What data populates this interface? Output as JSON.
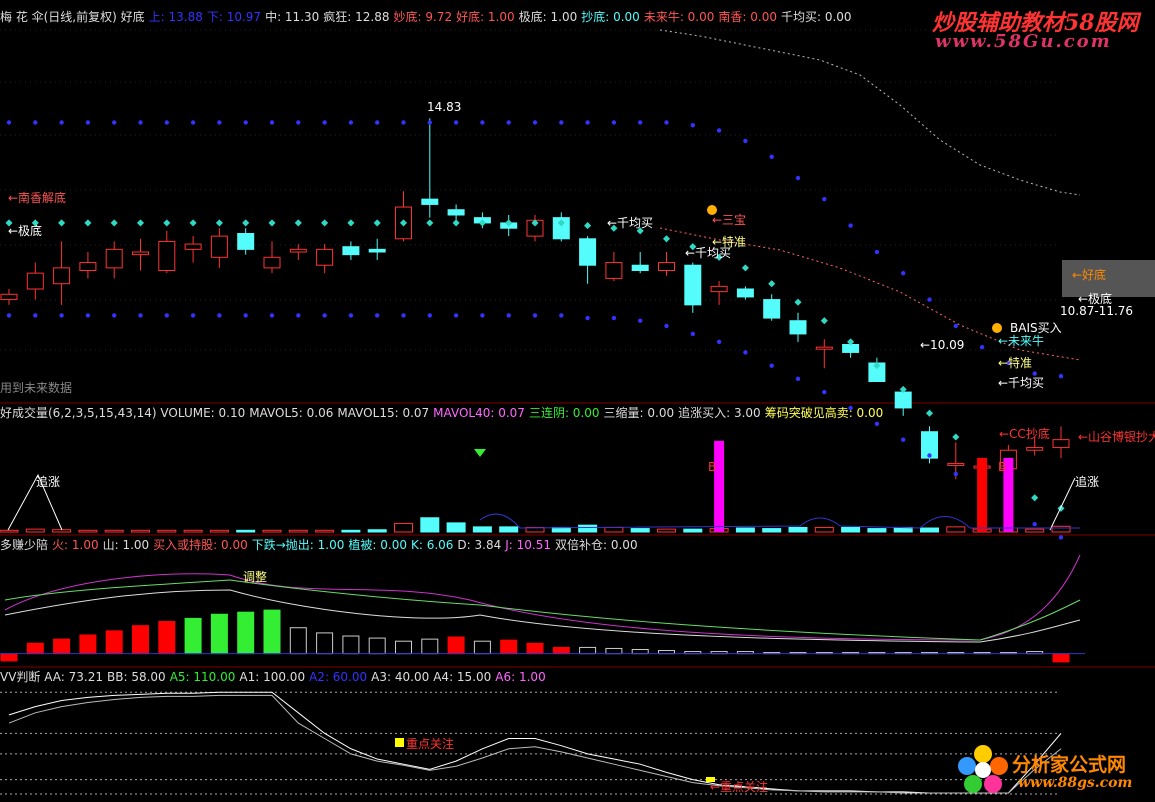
{
  "colors": {
    "bg": "#000000",
    "up": "#ff3232",
    "down": "#54fcfc",
    "text": "#dddddd",
    "cyan_dot": "#2fd9c4",
    "blue_dot": "#3333ff",
    "magenta": "#ff00ff",
    "red": "#ff0000",
    "green": "#33ee33",
    "yellow": "#ffff00",
    "grid_red": "#800000"
  },
  "header1": {
    "items": [
      {
        "text": "梅 花 伞(日线,前复权) 好底",
        "color": "#dddddd"
      },
      {
        "text": "上: 13.88",
        "color": "#3333ff"
      },
      {
        "text": "下: 10.97",
        "color": "#3333ff"
      },
      {
        "text": "中: 11.30",
        "color": "#dddddd"
      },
      {
        "text": "疯狂: 12.88",
        "color": "#dddddd"
      },
      {
        "text": "妙底: 9.72",
        "color": "#ff5555"
      },
      {
        "text": "好底: 1.00",
        "color": "#ff5555"
      },
      {
        "text": "极底: 1.00",
        "color": "#dddddd"
      },
      {
        "text": "抄底: 0.00",
        "color": "#54fcfc"
      },
      {
        "text": "未来牛: 0.00",
        "color": "#ff5555"
      },
      {
        "text": "南香: 0.00",
        "color": "#ff5555"
      },
      {
        "text": "千均买: 0.00",
        "color": "#dddddd"
      }
    ]
  },
  "header2": {
    "items": [
      {
        "text": "好成交量(6,2,3,5,15,43,14) VOLUME: 0.10",
        "color": "#dddddd"
      },
      {
        "text": "MAVOL5: 0.06",
        "color": "#dddddd"
      },
      {
        "text": "MAVOL15: 0.07",
        "color": "#dddddd"
      },
      {
        "text": "MAVOL40: 0.07",
        "color": "#ff66ff"
      },
      {
        "text": "三连阴: 0.00",
        "color": "#33ee33"
      },
      {
        "text": "三缩量: 0.00",
        "color": "#dddddd"
      },
      {
        "text": "追涨买入: 3.00",
        "color": "#dddddd"
      },
      {
        "text": "筹码突破见高卖: 0.00",
        "color": "#ffff55"
      }
    ]
  },
  "header3": {
    "items": [
      {
        "text": "多赚少陪",
        "color": "#dddddd"
      },
      {
        "text": "火: 1.00",
        "color": "#ff5555"
      },
      {
        "text": "山: 1.00",
        "color": "#dddddd"
      },
      {
        "text": "买入或持股: 0.00",
        "color": "#ff5555"
      },
      {
        "text": "下跌→抛出: 1.00",
        "color": "#54fcfc"
      },
      {
        "text": "植被: 0.00",
        "color": "#54fcfc"
      },
      {
        "text": "K: 6.06",
        "color": "#54fcfc"
      },
      {
        "text": "D: 3.84",
        "color": "#dddddd"
      },
      {
        "text": "J: 10.51",
        "color": "#ff66ff"
      },
      {
        "text": "双倍补仓: 0.00",
        "color": "#dddddd"
      }
    ]
  },
  "header4": {
    "items": [
      {
        "text": "VV判断 AA: 73.21",
        "color": "#dddddd"
      },
      {
        "text": "BB: 58.00",
        "color": "#dddddd"
      },
      {
        "text": "A5: 110.00",
        "color": "#33ee33"
      },
      {
        "text": "A1: 100.00",
        "color": "#dddddd"
      },
      {
        "text": "A2: 60.00",
        "color": "#3333ff"
      },
      {
        "text": "A3: 40.00",
        "color": "#dddddd"
      },
      {
        "text": "A4: 15.00",
        "color": "#dddddd"
      },
      {
        "text": "A6: 1.00",
        "color": "#ff66ff"
      }
    ]
  },
  "labels": {
    "price_high": "14.83",
    "price_low": "←10.09",
    "price_range": "10.87-11.76",
    "nanxiang_jiedi": "←南香解底",
    "jidi_left": "←极底",
    "qianjunmai_1": "←千均买",
    "qianjunmai_2": "←千均买",
    "sanbao": "←三宝",
    "tezhun_1": "←特准",
    "haodi": "←好底",
    "jidi_right": "←极底",
    "bais": "BAIS买入",
    "weilainiu": "←未来牛",
    "tezhun_2": "←特准",
    "qianjunmai_3": "←千均买",
    "future_data": "用到未来数据",
    "ccchaodi": "←CC抄底",
    "shangusha": "←山谷博银抄大",
    "zhuizhang_left": "追涨",
    "zhuizhang_right": "追涨",
    "b_mark_1": "B",
    "b_mark_2": "B",
    "tiaozheng": "调整",
    "zhongdian_1": "重点关注",
    "zhongdian_2": "←重点关注"
  },
  "watermark": {
    "line1": "炒股辅助教材58股网",
    "line2": "www.58Gu.com",
    "logo_text": "分析家公式网",
    "logo_url_text": "www.88gs.com"
  },
  "chart_data": [
    {
      "type": "candlestick",
      "title": "梅 花 伞(日线,前复权)",
      "ylim": [
        9.5,
        16.5
      ],
      "candles": [
        {
          "o": 11.4,
          "c": 11.5,
          "h": 11.6,
          "l": 11.3
        },
        {
          "o": 11.6,
          "c": 11.9,
          "h": 12.1,
          "l": 11.4
        },
        {
          "o": 11.7,
          "c": 12.0,
          "h": 12.5,
          "l": 11.3
        },
        {
          "o": 11.95,
          "c": 12.1,
          "h": 12.3,
          "l": 11.8
        },
        {
          "o": 12.0,
          "c": 12.35,
          "h": 12.5,
          "l": 11.8
        },
        {
          "o": 12.25,
          "c": 12.3,
          "h": 12.55,
          "l": 11.95
        },
        {
          "o": 11.95,
          "c": 12.5,
          "h": 12.7,
          "l": 11.9
        },
        {
          "o": 12.35,
          "c": 12.45,
          "h": 12.6,
          "l": 12.1
        },
        {
          "o": 12.2,
          "c": 12.6,
          "h": 12.75,
          "l": 12.0
        },
        {
          "o": 12.65,
          "c": 12.35,
          "h": 12.75,
          "l": 12.25
        },
        {
          "o": 12.0,
          "c": 12.2,
          "h": 12.5,
          "l": 11.9
        },
        {
          "o": 12.3,
          "c": 12.35,
          "h": 12.45,
          "l": 12.15
        },
        {
          "o": 12.05,
          "c": 12.35,
          "h": 12.45,
          "l": 11.9
        },
        {
          "o": 12.4,
          "c": 12.25,
          "h": 12.5,
          "l": 12.15
        },
        {
          "o": 12.35,
          "c": 12.3,
          "h": 12.55,
          "l": 12.15
        },
        {
          "o": 12.55,
          "c": 13.15,
          "h": 13.45,
          "l": 12.5
        },
        {
          "o": 13.3,
          "c": 13.2,
          "h": 14.83,
          "l": 12.95
        },
        {
          "o": 13.1,
          "c": 13.0,
          "h": 13.2,
          "l": 12.85
        },
        {
          "o": 12.95,
          "c": 12.85,
          "h": 13.05,
          "l": 12.75
        },
        {
          "o": 12.85,
          "c": 12.75,
          "h": 13.0,
          "l": 12.6
        },
        {
          "o": 12.6,
          "c": 12.9,
          "h": 13.0,
          "l": 12.5
        },
        {
          "o": 12.95,
          "c": 12.55,
          "h": 13.05,
          "l": 12.5
        },
        {
          "o": 12.55,
          "c": 12.05,
          "h": 12.6,
          "l": 11.7
        },
        {
          "o": 11.8,
          "c": 12.1,
          "h": 12.3,
          "l": 11.75
        },
        {
          "o": 12.05,
          "c": 11.95,
          "h": 12.3,
          "l": 11.9
        },
        {
          "o": 11.95,
          "c": 12.1,
          "h": 12.3,
          "l": 11.85
        },
        {
          "o": 12.05,
          "c": 11.3,
          "h": 12.1,
          "l": 11.15
        },
        {
          "o": 11.55,
          "c": 11.65,
          "h": 11.75,
          "l": 11.3
        },
        {
          "o": 11.6,
          "c": 11.45,
          "h": 11.65,
          "l": 11.4
        },
        {
          "o": 11.4,
          "c": 11.05,
          "h": 11.5,
          "l": 11.0
        },
        {
          "o": 11.0,
          "c": 10.75,
          "h": 11.15,
          "l": 10.6
        },
        {
          "o": 10.5,
          "c": 10.5,
          "h": 10.65,
          "l": 10.1
        },
        {
          "o": 10.55,
          "c": 10.4,
          "h": 10.65,
          "l": 10.3
        },
        {
          "o": 10.2,
          "c": 9.85,
          "h": 10.3,
          "l": 9.85
        },
        {
          "o": 9.65,
          "c": 9.35,
          "h": 9.75,
          "l": 9.2
        },
        {
          "o": 8.9,
          "c": 8.4,
          "h": 9.0,
          "l": 8.3
        },
        {
          "o": 8.3,
          "c": 8.3,
          "h": 8.7,
          "l": 8.0
        },
        {
          "o": 8.25,
          "c": 8.25,
          "h": 8.4,
          "l": 8.1
        },
        {
          "o": 8.2,
          "c": 8.55,
          "h": 8.65,
          "l": 8.0
        },
        {
          "o": 8.55,
          "c": 8.6,
          "h": 8.8,
          "l": 8.45
        },
        {
          "o": 8.6,
          "c": 8.75,
          "h": 9.0,
          "l": 8.4
        }
      ],
      "upper_dots": [
        14.75,
        14.75,
        14.75,
        14.75,
        14.75,
        14.75,
        14.75,
        14.75,
        14.75,
        14.75,
        14.75,
        14.75,
        14.75,
        14.75,
        14.75,
        14.75,
        14.75,
        14.75,
        14.75,
        14.75,
        14.75,
        14.75,
        14.75,
        14.75,
        14.75,
        14.75,
        14.7,
        14.6,
        14.4,
        14.1,
        13.7,
        13.3,
        12.8,
        12.3,
        11.9,
        11.4,
        10.9,
        10.5,
        10.2,
        10.0,
        9.95
      ],
      "mid_dots": [
        12.85,
        12.85,
        12.85,
        12.85,
        12.85,
        12.85,
        12.85,
        12.85,
        12.85,
        12.85,
        12.85,
        12.85,
        12.85,
        12.85,
        12.85,
        12.85,
        12.85,
        12.85,
        12.85,
        12.85,
        12.85,
        12.85,
        12.8,
        12.75,
        12.7,
        12.55,
        12.4,
        12.2,
        12.0,
        11.7,
        11.35,
        11.0,
        10.6,
        10.15,
        9.7,
        9.25,
        8.8,
        8.3,
        7.95,
        7.65,
        7.45
      ],
      "lower_dots": [
        11.1,
        11.1,
        11.1,
        11.1,
        11.1,
        11.1,
        11.1,
        11.1,
        11.1,
        11.1,
        11.1,
        11.1,
        11.1,
        11.1,
        11.1,
        11.1,
        11.1,
        11.1,
        11.1,
        11.1,
        11.1,
        11.1,
        11.05,
        11.05,
        11.0,
        10.9,
        10.75,
        10.6,
        10.4,
        10.15,
        9.9,
        9.65,
        9.35,
        9.05,
        8.75,
        8.45,
        8.1,
        7.75,
        7.45,
        7.15,
        6.9
      ]
    },
    {
      "type": "bar",
      "title": "好成交量(6,2,3,5,15,43,14)",
      "volume": [
        0.3,
        0.5,
        0.4,
        0.3,
        0.3,
        0.3,
        0.3,
        0.3,
        0.3,
        0.3,
        0.3,
        0.3,
        0.3,
        0.3,
        0.4,
        1.5,
        2.5,
        1.6,
        0.9,
        0.9,
        0.8,
        0.8,
        1.2,
        0.8,
        0.6,
        0.5,
        0.5,
        0.6,
        0.7,
        0.6,
        0.8,
        0.8,
        0.8,
        0.6,
        0.8,
        0.7,
        0.9,
        0.5,
        0.7,
        0.5,
        1.0
      ],
      "b_signal_bars": [
        {
          "index": 27,
          "value": 16
        },
        {
          "index": 37,
          "value": 13
        },
        {
          "index": 38,
          "value": 13
        }
      ],
      "ylim": [
        0,
        20
      ]
    },
    {
      "type": "bar",
      "title": "多赚少陪",
      "values": [
        -7,
        10,
        14,
        18,
        22,
        27,
        31,
        34,
        38,
        40,
        42,
        25,
        20,
        17,
        15,
        12,
        14,
        16,
        12,
        13,
        10,
        6,
        6,
        5,
        4,
        3,
        2,
        2,
        2,
        1,
        1,
        1,
        1,
        1,
        1,
        1,
        1,
        1,
        1,
        2,
        -8
      ],
      "signs": [
        "red",
        "red",
        "red",
        "red",
        "red",
        "red",
        "red",
        "green",
        "green",
        "green",
        "green",
        "hollow",
        "hollow",
        "hollow",
        "hollow",
        "hollow",
        "hollow",
        "red",
        "hollow",
        "red",
        "red",
        "red",
        "hollow",
        "hollow",
        "hollow",
        "hollow",
        "hollow",
        "hollow",
        "hollow",
        "hollow",
        "hollow",
        "hollow",
        "hollow",
        "hollow",
        "hollow",
        "hollow",
        "hollow",
        "hollow",
        "hollow",
        "hollow",
        "red"
      ],
      "ylim": [
        -10,
        100
      ]
    },
    {
      "type": "line",
      "title": "VV判断",
      "series_a": [
        78,
        86,
        92,
        95,
        97,
        98,
        99,
        99,
        100,
        100,
        100,
        80,
        60,
        45,
        35,
        30,
        25,
        33,
        45,
        55,
        55,
        48,
        40,
        35,
        30,
        22,
        15,
        10,
        8,
        6,
        4,
        4,
        4,
        3,
        3,
        2,
        2,
        2,
        2,
        30,
        60
      ],
      "series_b": [
        70,
        80,
        86,
        90,
        93,
        95,
        96,
        96,
        97,
        97,
        97,
        70,
        55,
        40,
        33,
        29,
        24,
        28,
        36,
        45,
        47,
        42,
        36,
        30,
        24,
        18,
        12,
        9,
        7,
        5,
        4,
        3,
        3,
        3,
        2,
        2,
        2,
        2,
        2,
        25,
        45
      ],
      "ylim": [
        0,
        110
      ]
    }
  ]
}
